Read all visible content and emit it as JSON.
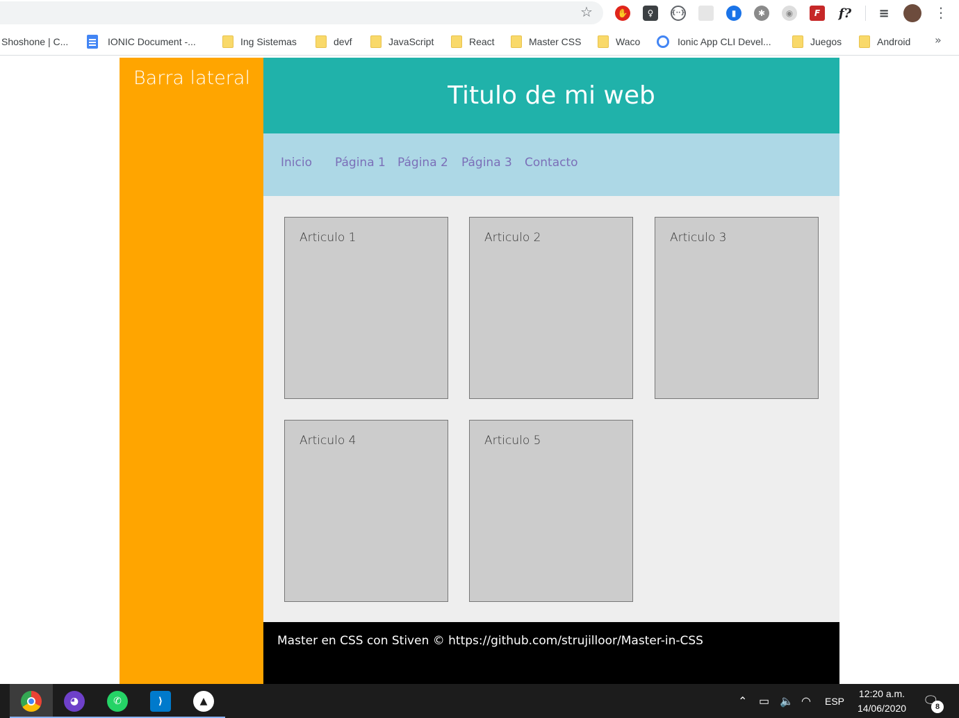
{
  "browser": {
    "bookmarks": [
      {
        "label": "Shoshone | C...",
        "icon": "none"
      },
      {
        "label": "IONIC Document -...",
        "icon": "doc-icon"
      },
      {
        "label": "Ing Sistemas",
        "icon": "folder-icon"
      },
      {
        "label": "devf",
        "icon": "folder-icon"
      },
      {
        "label": "JavaScript",
        "icon": "folder-icon"
      },
      {
        "label": "React",
        "icon": "folder-icon"
      },
      {
        "label": "Master CSS",
        "icon": "folder-icon"
      },
      {
        "label": "Waco",
        "icon": "folder-icon"
      },
      {
        "label": "Ionic App CLI Devel...",
        "icon": "globe-icon"
      },
      {
        "label": "Juegos",
        "icon": "folder-icon"
      },
      {
        "label": "Android",
        "icon": "folder-icon"
      }
    ],
    "bookmarks_more": "»",
    "extensions": [
      "adblock-icon",
      "lightbulb-icon",
      "code-icon",
      "grid-icon",
      "bookmark-icon",
      "gear-icon",
      "record-icon",
      "formula-icon",
      "font-icon",
      "media-icon",
      "profile-avatar"
    ],
    "extension_text": {
      "formula": "F",
      "font": "f?"
    }
  },
  "page": {
    "sidebar_title": "Barra lateral",
    "header_title": "Titulo de mi web",
    "nav": [
      "Inicio",
      "Página 1",
      "Página 2",
      "Página 3",
      "Contacto"
    ],
    "articles": [
      "Articulo 1",
      "Articulo 2",
      "Articulo 3",
      "Articulo 4",
      "Articulo 5"
    ],
    "footer": "Master en CSS con Stiven © https://github.com/strujilloor/Master-in-CSS",
    "colors": {
      "sidebar": "#ffa500",
      "header": "#20b2aa",
      "nav": "#add8e6",
      "content": "#eeeeee",
      "article": "#cccccc",
      "footer": "#000000"
    }
  },
  "taskbar": {
    "apps": [
      "chrome-icon",
      "github-desktop-icon",
      "whatsapp-icon",
      "vscode-icon",
      "photo-app-icon"
    ],
    "language": "ESP",
    "time": "12:20 a.m.",
    "date": "14/06/2020",
    "notifications": "8"
  }
}
